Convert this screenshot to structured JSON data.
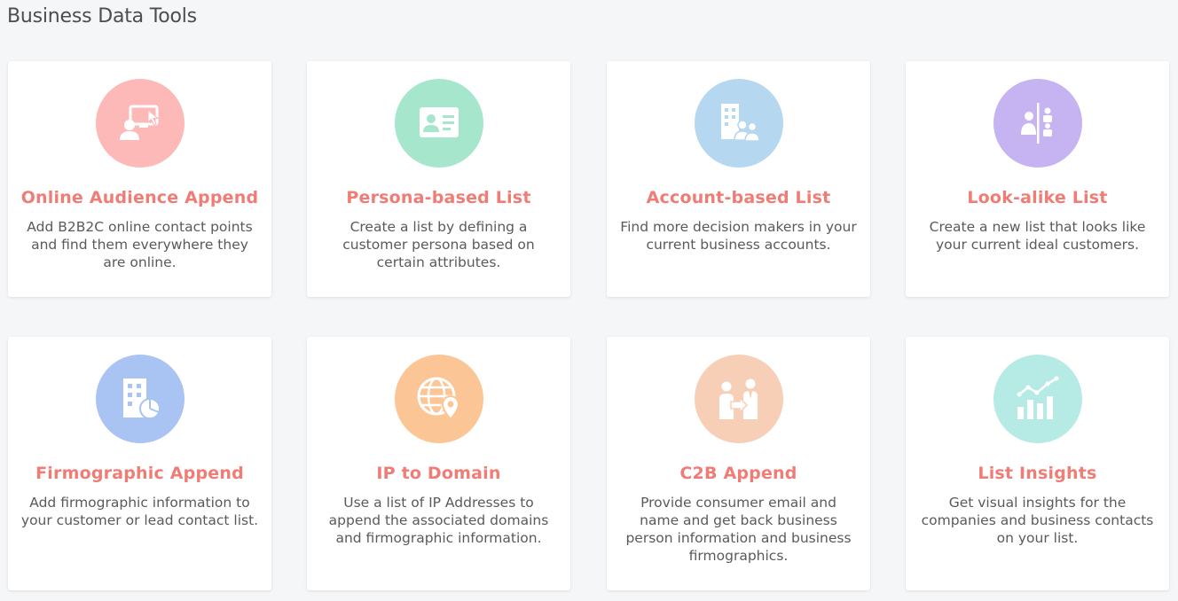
{
  "page": {
    "title": "Business Data Tools"
  },
  "tools": [
    {
      "title": "Online Audience Append",
      "description": "Add B2B2C online contact points and find them everywhere they are online.",
      "icon": "online-audience-icon",
      "color": "#fdb8b8"
    },
    {
      "title": "Persona-based List",
      "description": "Create a list by defining a customer persona based on certain attributes.",
      "icon": "persona-card-icon",
      "color": "#a6e6cc"
    },
    {
      "title": "Account-based List",
      "description": "Find more decision makers in your current business accounts.",
      "icon": "building-people-icon",
      "color": "#b5d7f0"
    },
    {
      "title": "Look-alike List",
      "description": "Create a new list that looks like your current ideal customers.",
      "icon": "lookalike-people-icon",
      "color": "#c5b3f2"
    },
    {
      "title": "Firmographic Append",
      "description": "Add firmographic information to your customer or lead contact list.",
      "icon": "building-chart-icon",
      "color": "#a9c3f3"
    },
    {
      "title": "IP to Domain",
      "description": "Use a list of IP Addresses to append the associated domains and firmographic information.",
      "icon": "globe-pin-icon",
      "color": "#fcc595"
    },
    {
      "title": "C2B Append",
      "description": "Provide consumer email and name and get back business person information and business firmographics.",
      "icon": "consumer-to-business-icon",
      "color": "#f6cfb6"
    },
    {
      "title": "List Insights",
      "description": "Get visual insights for the companies and business contacts on your list.",
      "icon": "bar-chart-trend-icon",
      "color": "#b6ebe5"
    }
  ]
}
